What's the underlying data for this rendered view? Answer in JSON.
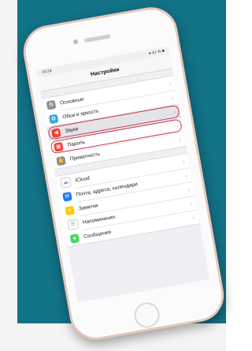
{
  "status": {
    "time": "19:24",
    "battery": "● 41 % ■"
  },
  "screen": {
    "title": "Настройки"
  },
  "groups": [
    {
      "rows": [
        {
          "label": "Основные",
          "icon": "gear-icon",
          "color": "#8e8e93"
        },
        {
          "label": "Обои и яркость",
          "icon": "wallpaper-icon",
          "color": "#34aadc"
        },
        {
          "label": "Звуки",
          "icon": "sound-icon",
          "color": "#ff3b30"
        },
        {
          "label": "Пароль",
          "icon": "lock-icon",
          "color": "#ff3b30"
        },
        {
          "label": "Приватность",
          "icon": "hand-icon",
          "color": "#8e8e93"
        }
      ]
    },
    {
      "rows": [
        {
          "label": "iCloud",
          "icon": "cloud-icon",
          "color": "#ffffff"
        },
        {
          "label": "Почта, адреса, календари",
          "icon": "mail-icon",
          "color": "#1e7cf2"
        },
        {
          "label": "Заметки",
          "icon": "notes-icon",
          "color": "#ffcc00"
        },
        {
          "label": "Напоминания",
          "icon": "reminders-icon",
          "color": "#ffffff"
        },
        {
          "label": "Сообщения",
          "icon": "messages-icon",
          "color": "#4cd964"
        }
      ]
    }
  ]
}
